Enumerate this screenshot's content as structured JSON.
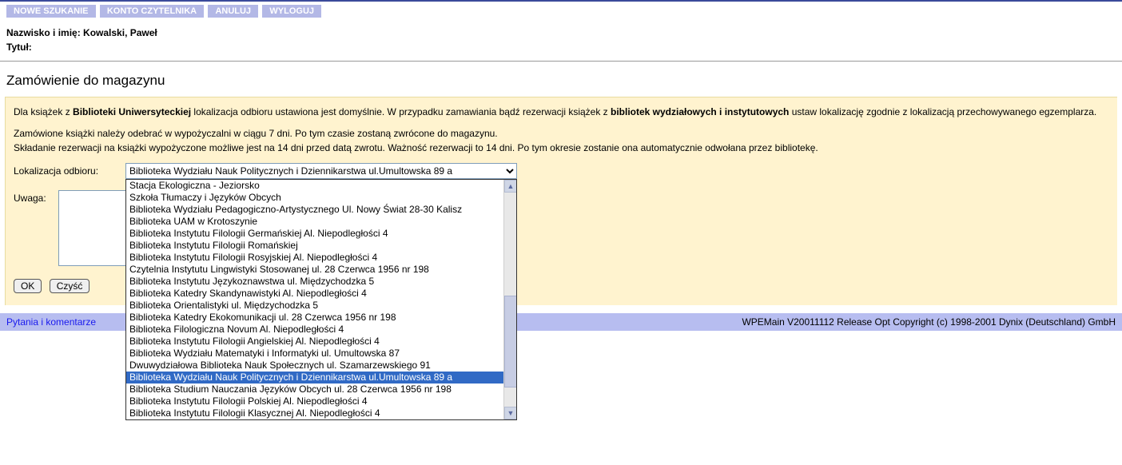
{
  "toolbar": {
    "new_search": "NOWE SZUKANIE",
    "account": "KONTO CZYTELNIKA",
    "cancel": "ANULUJ",
    "logout": "WYLOGUJ"
  },
  "user": {
    "name_label": "Nazwisko i imię:",
    "name_value": "Kowalski, Paweł",
    "title_label": "Tytuł:",
    "title_value": ""
  },
  "section": {
    "heading": "Zamówienie do magazynu"
  },
  "info": {
    "p1_a": "Dla książek z ",
    "p1_b": "Biblioteki Uniwersyteckiej",
    "p1_c": " lokalizacja odbioru ustawiona jest domyślnie. W przypadku zamawiania bądź rezerwacji książek z ",
    "p1_d": "bibliotek wydziałowych i instytutowych",
    "p1_e": " ustaw lokalizację zgodnie z lokalizacją przechowywanego egzemplarza.",
    "p2": "Zamówione książki należy odebrać w wypożyczalni w ciągu 7 dni. Po tym czasie zostaną zwrócone do magazynu.",
    "p3": "Składanie rezerwacji na książki wypożyczone możliwe jest na 14 dni przed datą zwrotu. Ważność rezerwacji to 14 dni. Po tym okresie zostanie ona automatycznie odwołana przez bibliotekę."
  },
  "form": {
    "location_label": "Lokalizacja odbioru:",
    "location_selected": "Biblioteka Wydziału Nauk Politycznych i Dziennikarstwa ul.Umultowska 89 a",
    "note_label": "Uwaga:",
    "note_value": "",
    "ok_label": "OK",
    "clear_label": "Czyść",
    "options": [
      {
        "label": "Stacja Ekologiczna - Jeziorsko",
        "selected": false
      },
      {
        "label": "Szkoła Tłumaczy i Języków Obcych",
        "selected": false
      },
      {
        "label": "Biblioteka Wydziału Pedagogiczno-Artystycznego Ul. Nowy Świat 28-30 Kalisz",
        "selected": false
      },
      {
        "label": "Biblioteka UAM w Krotoszynie",
        "selected": false
      },
      {
        "label": "Biblioteka Instytutu Filologii Germańskiej Al. Niepodległości 4",
        "selected": false
      },
      {
        "label": "Biblioteka Instytutu Filologii Romańskiej",
        "selected": false
      },
      {
        "label": "Biblioteka Instytutu Filologii Rosyjskiej Al. Niepodległości 4",
        "selected": false
      },
      {
        "label": "Czytelnia Instytutu Lingwistyki Stosowanej ul. 28 Czerwca 1956 nr 198",
        "selected": false
      },
      {
        "label": "Biblioteka Instytutu Językoznawstwa ul. Międzychodzka 5",
        "selected": false
      },
      {
        "label": "Biblioteka Katedry Skandynawistyki Al. Niepodległości 4",
        "selected": false
      },
      {
        "label": "Biblioteka Orientalistyki ul. Międzychodzka 5",
        "selected": false
      },
      {
        "label": "Biblioteka Katedry Ekokomunikacji ul. 28 Czerwca 1956 nr 198",
        "selected": false
      },
      {
        "label": "Biblioteka Filologiczna Novum Al. Niepodległości 4",
        "selected": false
      },
      {
        "label": "Biblioteka Instytutu Filologii Angielskiej Al. Niepodległości 4",
        "selected": false
      },
      {
        "label": "Biblioteka Wydziału Matematyki i Informatyki ul. Umultowska 87",
        "selected": false
      },
      {
        "label": "Dwuwydziałowa Biblioteka Nauk Społecznych ul. Szamarzewskiego 91",
        "selected": false
      },
      {
        "label": "Biblioteka Wydziału Nauk Politycznych i Dziennikarstwa ul.Umultowska 89 a",
        "selected": true
      },
      {
        "label": "Biblioteka Studium Nauczania Języków Obcych ul. 28 Czerwca 1956 nr 198",
        "selected": false
      },
      {
        "label": "Biblioteka Instytutu Filologii Polskiej Al. Niepodległości 4",
        "selected": false
      },
      {
        "label": "Biblioteka Instytutu Filologii Klasycznej Al. Niepodległości 4",
        "selected": false
      }
    ]
  },
  "footer": {
    "link": "Pytania i komentarze",
    "copyright": "WPEMain V20011112 Release Opt Copyright (c) 1998-2001 Dynix (Deutschland) GmbH"
  }
}
